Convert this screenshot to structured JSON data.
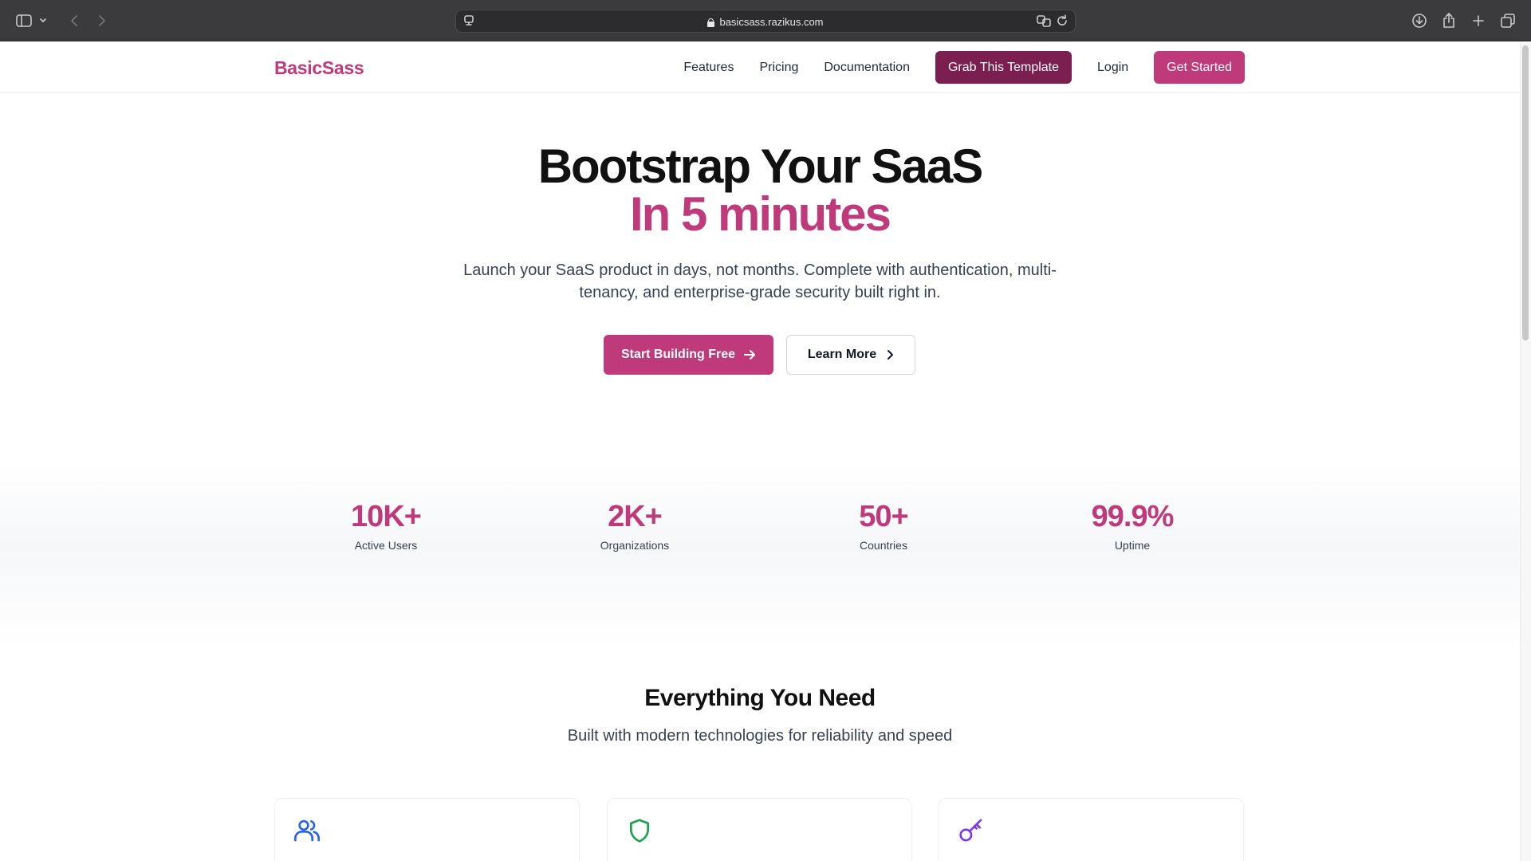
{
  "browser": {
    "url": "basicsass.razikus.com"
  },
  "nav": {
    "logo": "BasicSass",
    "links": [
      "Features",
      "Pricing",
      "Documentation"
    ],
    "template_button": "Grab This Template",
    "login": "Login",
    "get_started": "Get Started"
  },
  "hero": {
    "title": "Bootstrap Your SaaS",
    "subtitle": "In 5 minutes",
    "description": "Launch your SaaS product in days, not months. Complete with authentication, multi-tenancy, and enterprise-grade security built right in.",
    "primary_cta": "Start Building Free",
    "secondary_cta": "Learn More"
  },
  "stats": [
    {
      "value": "10K+",
      "label": "Active Users"
    },
    {
      "value": "2K+",
      "label": "Organizations"
    },
    {
      "value": "50+",
      "label": "Countries"
    },
    {
      "value": "99.9%",
      "label": "Uptime"
    }
  ],
  "features": {
    "title": "Everything You Need",
    "subtitle": "Built with modern technologies for reliability and speed",
    "cards": [
      {
        "icon": "users-icon",
        "color": "#2563eb"
      },
      {
        "icon": "shield-icon",
        "color": "#16a34a"
      },
      {
        "icon": "key-icon",
        "color": "#7c3aed"
      }
    ]
  },
  "colors": {
    "brand": "#be3a7a",
    "brand_dark": "#7a1f4f"
  }
}
